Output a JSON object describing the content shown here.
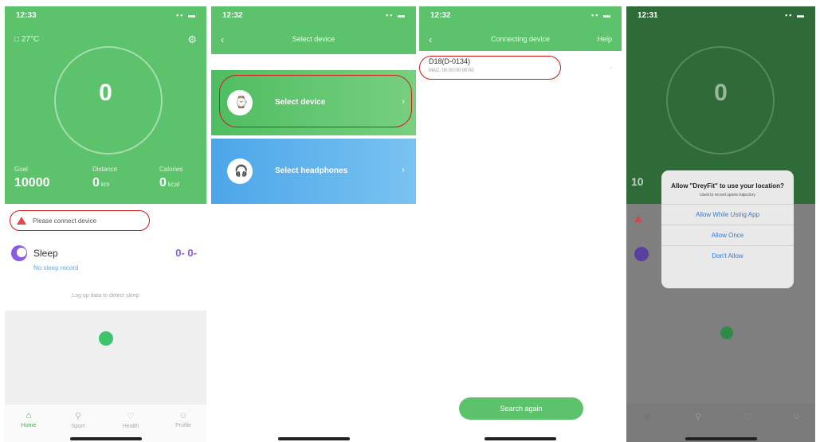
{
  "screen1": {
    "status_time": "12:33",
    "location": "□ 27°C",
    "steps": "0",
    "stats": [
      {
        "label": "Goal",
        "value": "10000",
        "unit": ""
      },
      {
        "label": "Distance",
        "value": "0",
        "unit": "km"
      },
      {
        "label": "Calories",
        "value": "0",
        "unit": "kcal"
      }
    ],
    "connect_text": "Please connect device",
    "sleep_title": "Sleep",
    "sleep_sub": "No sleep record",
    "sleep_value": "0- 0-",
    "sleep_hint": "Log up data to detect sleep",
    "tabs": [
      "Home",
      "Sport",
      "Health",
      "Profile"
    ]
  },
  "screen2": {
    "status_time": "12:32",
    "title": "Select device",
    "card1_label": "Select device",
    "card2_label": "Select headphones"
  },
  "screen3": {
    "status_time": "12:32",
    "title": "Connecting device",
    "right_action": "Help",
    "device_name": "D18(D-0134)",
    "device_mac": "MAC: 00:00:00:00:00",
    "search_label": "Search again"
  },
  "screen4": {
    "status_time": "12:31",
    "zero": "0",
    "stat_partial": "10",
    "dialog_title": "Allow \"DreyFit\" to use your location?",
    "dialog_msg": "Used to record sports trajectory",
    "btn_while": "Allow While Using App",
    "btn_once": "Allow Once",
    "btn_deny": "Don't Allow"
  },
  "colors": {
    "accent": "#5cc26b",
    "highlight": "#d01818",
    "blue": "#4ba6e8"
  }
}
